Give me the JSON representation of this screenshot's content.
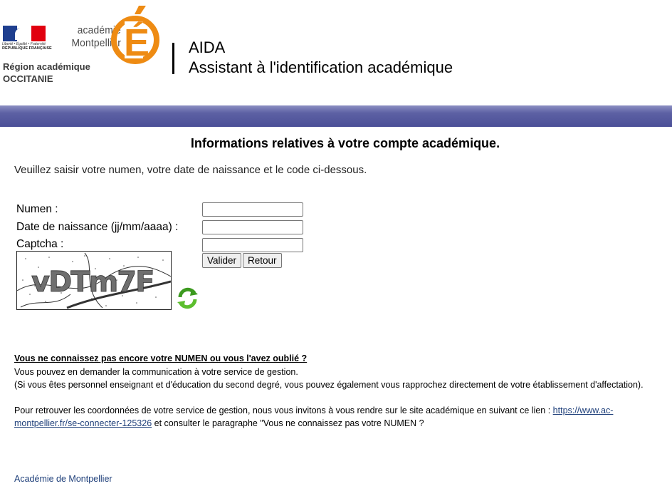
{
  "header": {
    "flag_colors": [
      "#1f3f8f",
      "#ffffff",
      "#e1000f"
    ],
    "devise": "Liberté • Égalité • Fraternité",
    "republique": "RÉPUBLIQUE FRANÇAISE",
    "region_line1": "Région académique",
    "region_line2": "OCCITANIE",
    "academie_line1": "académie",
    "academie_line2": "Montpellier",
    "logo_letter": "É",
    "logo_color": "#ee8b13",
    "app_name": "AIDA",
    "app_subtitle": "Assistant à l'identification académique"
  },
  "band_color": "#4b4f97",
  "main": {
    "title": "Informations relatives à votre compte académique.",
    "intro": "Veuillez saisir votre numen, votre date de naissance et le code ci-dessous."
  },
  "form": {
    "numen_label": "Numen :",
    "numen_value": "",
    "dob_label": "Date de naissance (jj/mm/aaaa) :",
    "dob_value": "",
    "captcha_label": "Captcha :",
    "captcha_value": "",
    "captcha_text": "vDTm7F",
    "valider_label": "Valider",
    "retour_label": "Retour",
    "refresh_icon": "refresh-icon"
  },
  "help": {
    "question": "Vous ne connaissez pas encore votre NUMEN ou vous l'avez oublié ?",
    "line1": "Vous pouvez en demander la communication à votre service de gestion.",
    "line2": "(Si vous êtes personnel enseignant et d'éducation du second degré, vous pouvez également vous rapprochez directement de votre établissement d'affectation).",
    "line3_prefix": "Pour retrouver les coordonnées de votre service de gestion, nous vous invitons à vous rendre sur le site académique en suivant ce lien : ",
    "link_part1": "https://www.ac-",
    "link_part2": "montpellier.fr/se-connecter-125326",
    "line4_suffix": " et consulter le paragraphe \"Vous ne connaissez pas votre NUMEN ?"
  },
  "footer": {
    "label": "Académie de Montpellier"
  }
}
